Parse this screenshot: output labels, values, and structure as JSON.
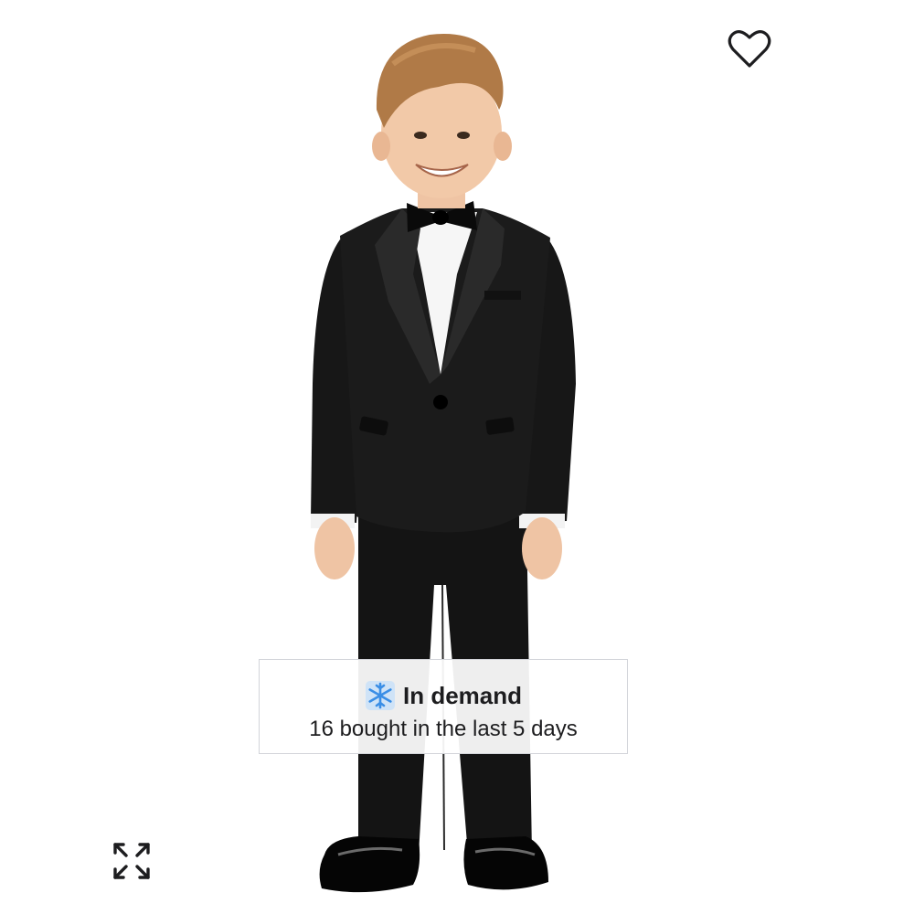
{
  "product": {
    "image_alt": "Boy wearing black tuxedo suit with white shirt and black bow tie"
  },
  "icons": {
    "wishlist": "heart-outline-icon",
    "expand": "expand-arrows-icon",
    "badge": "snowflake-icon"
  },
  "badge": {
    "title": "In demand",
    "subtitle": "16 bought in the last 5 days"
  },
  "colors": {
    "text": "#1d1d1f",
    "snowflake": "#3a8ee6",
    "badge_border": "#d2d4d9"
  }
}
